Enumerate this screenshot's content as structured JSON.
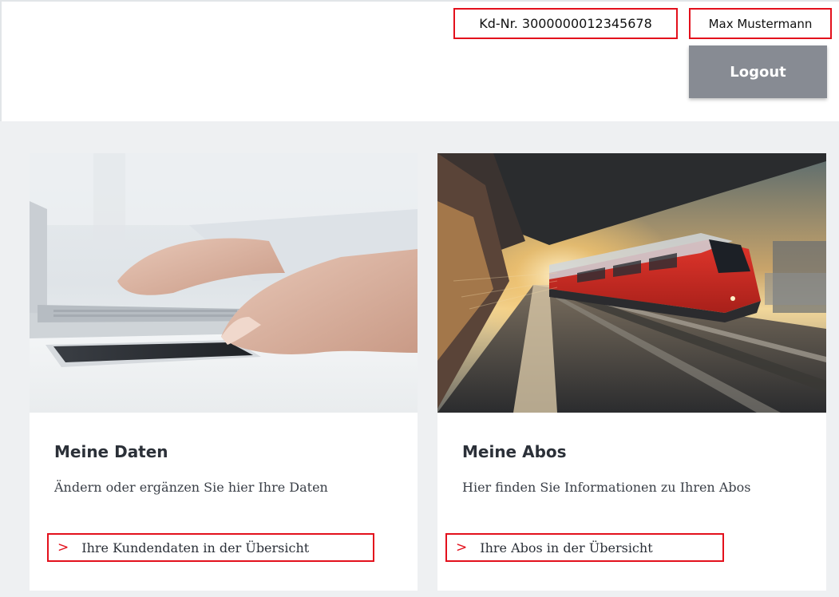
{
  "header": {
    "customer_number": "Kd-Nr. 3000000012345678",
    "user_name": "Max Mustermann",
    "logout_label": "Logout"
  },
  "cards": [
    {
      "title": "Meine Daten",
      "text": "Ändern oder ergänzen Sie hier Ihre Daten",
      "link_label": "Ihre Kundendaten in der Übersicht"
    },
    {
      "title": "Meine Abos",
      "text": "Hier finden Sie Informationen zu Ihren Abos",
      "link_label": "Ihre Abos in der Übersicht"
    }
  ],
  "icons": {
    "link_chevron": "chevron-right-icon"
  },
  "colors": {
    "accent": "#e3101c",
    "logout_bg": "#878b93",
    "page_bg": "#eef0f2"
  }
}
